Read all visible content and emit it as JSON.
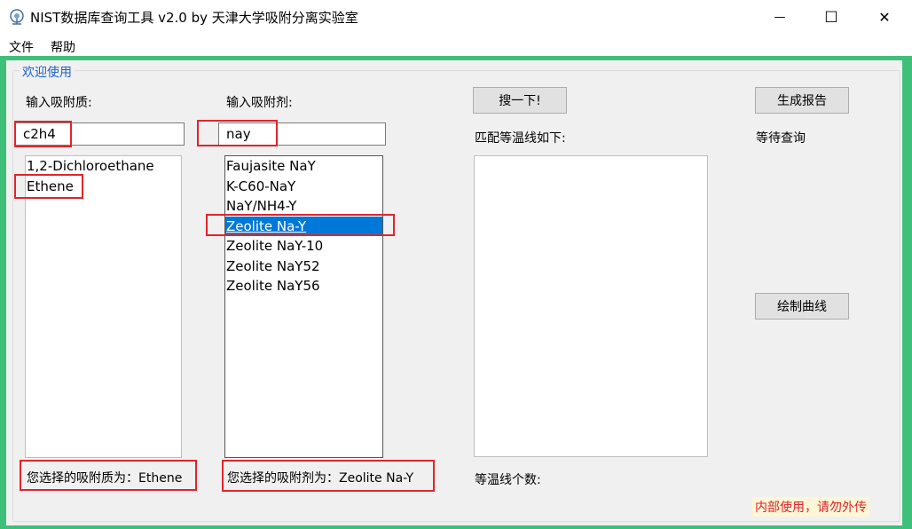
{
  "window": {
    "title": "NIST数据库查询工具 v2.0 by 天津大学吸附分离实验室",
    "minimize_glyph": "—",
    "maximize_glyph": "☐",
    "close_glyph": "✕",
    "frame_color": "#3ec07b"
  },
  "menu": {
    "file": "文件",
    "help": "帮助"
  },
  "group": {
    "title": "欢迎使用"
  },
  "adsorbate": {
    "label": "输入吸附质:",
    "input_value": "c2h4",
    "items": [
      "1,2-Dichloroethane",
      "Ethene"
    ],
    "selection_label": "您选择的吸附质为：Ethene"
  },
  "adsorbent": {
    "label": "输入吸附剂:",
    "input_value": "nay",
    "items": [
      "Faujasite NaY",
      "K-C60-NaY",
      "NaY/NH4-Y",
      "Zeolite Na-Y",
      "Zeolite NaY-10",
      "Zeolite NaY52",
      "Zeolite NaY56"
    ],
    "selected_index": 3,
    "selection_label": "您选择的吸附剂为：Zeolite Na-Y"
  },
  "search": {
    "button": "搜一下!"
  },
  "isotherms": {
    "label": "匹配等温线如下:",
    "count_label": "等温线个数:"
  },
  "report": {
    "button": "生成报告",
    "status": "等待查询"
  },
  "plot": {
    "button": "绘制曲线"
  },
  "notice": "内部使用，请勿外传",
  "colors": {
    "selection": "#0078d7",
    "highlight_box": "#e0242b",
    "group_title": "#1e63c8"
  }
}
